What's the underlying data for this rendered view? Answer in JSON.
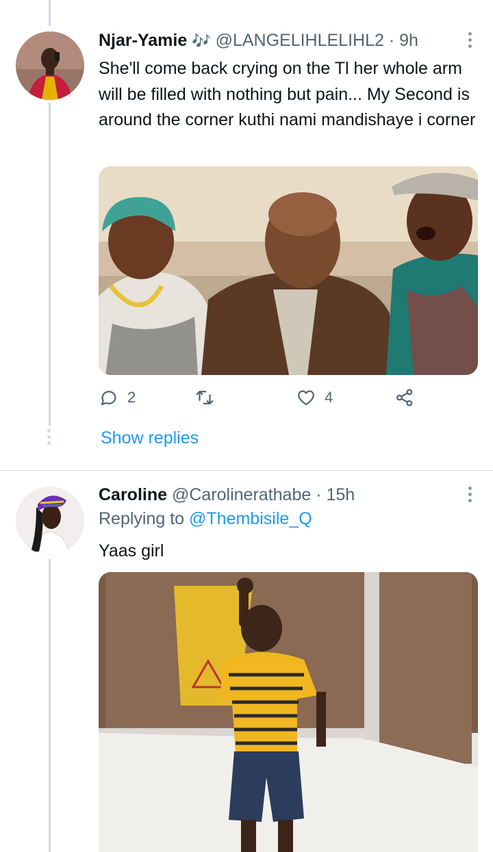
{
  "tweets": [
    {
      "name": "Njar-Yamie",
      "name_emoji": "🎶",
      "handle": "@LANGELIHLELIHL2",
      "time": "9h",
      "text": "She'll come back crying on the Tl her whole arm will be filled with nothing but pain... My Second is around the corner kuthi nami mandishaye i corner",
      "actions": {
        "replies": "2",
        "retweets": "",
        "likes": "4"
      },
      "show_replies": "Show replies",
      "avatar_icon": "profile-photo-man-red-shirt",
      "media_icon": "photo-three-elderly-people"
    },
    {
      "name": "Caroline",
      "handle": "@Carolinerathabe",
      "time": "15h",
      "replying_prefix": "Replying to",
      "replying_to": "@Thembisile_Q",
      "text": "Yaas girl",
      "avatar_icon": "profile-photo-woman-headwrap",
      "media_icon": "photo-child-thumbs-up"
    }
  ],
  "colors": {
    "link_blue": "#1d9bf0",
    "secondary_text": "#536471",
    "divider": "#cfd9de"
  },
  "dot_separator": "·"
}
